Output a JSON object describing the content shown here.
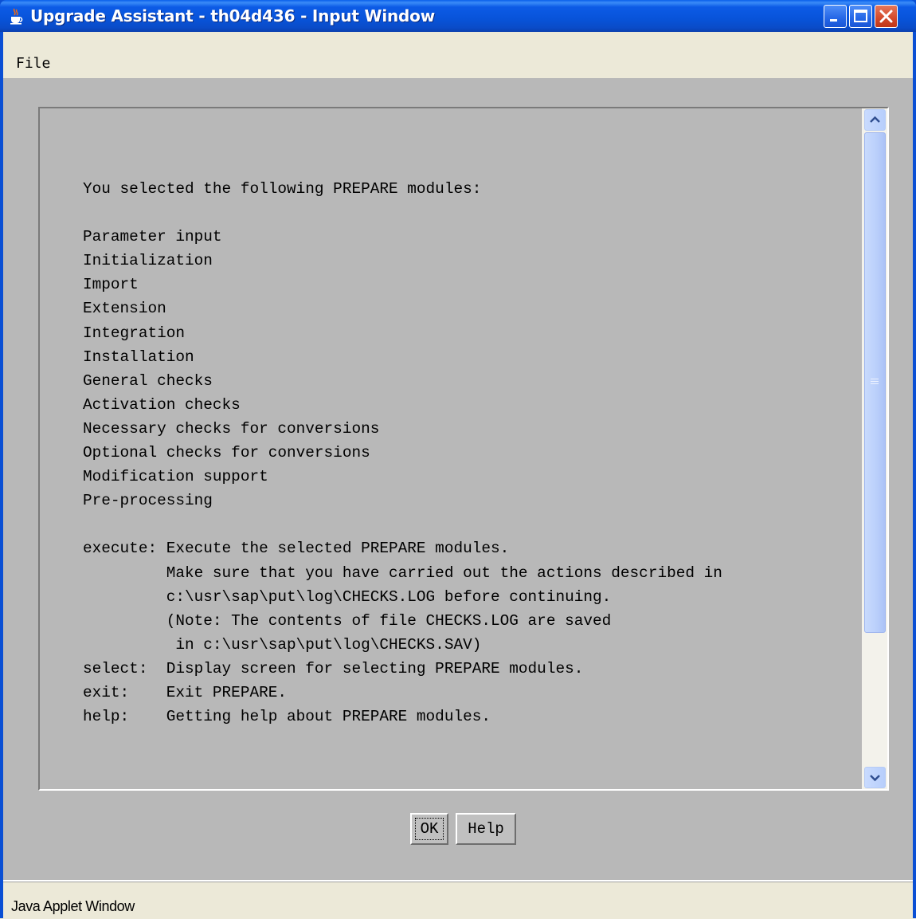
{
  "window": {
    "title": "Upgrade Assistant - th04d436 - Input Window",
    "app_icon": "java-cup-icon",
    "controls": [
      "minimize-icon",
      "maximize-icon",
      "close-icon"
    ],
    "accent_color": "#0A4FD4"
  },
  "menubar": {
    "items": [
      {
        "label": "File"
      }
    ]
  },
  "content": {
    "text": "You selected the following PREPARE modules:\n\nParameter input\nInitialization\nImport\nExtension\nIntegration\nInstallation\nGeneral checks\nActivation checks\nNecessary checks for conversions\nOptional checks for conversions\nModification support\nPre-processing\n\nexecute: Execute the selected PREPARE modules.\n         Make sure that you have carried out the actions described in\n         c:\\usr\\sap\\put\\log\\CHECKS.LOG before continuing.\n         (Note: The contents of file CHECKS.LOG are saved\n          in c:\\usr\\sap\\put\\log\\CHECKS.SAV)\nselect:  Display screen for selecting PREPARE modules.\nexit:    Exit PREPARE.\nhelp:    Getting help about PREPARE modules."
  },
  "buttons": {
    "ok_label": "OK",
    "help_label": "Help"
  },
  "status": {
    "text": "Java Applet Window"
  }
}
